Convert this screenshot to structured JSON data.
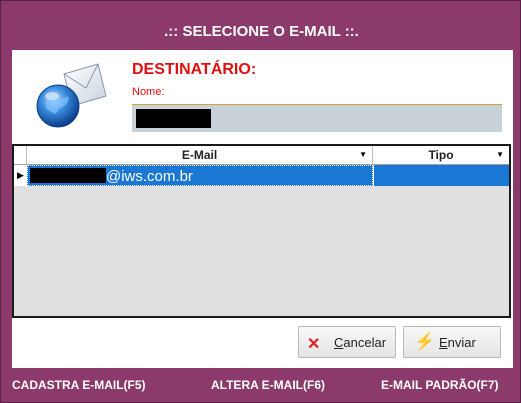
{
  "window": {
    "title": ".:: SELECIONE O E-MAIL ::."
  },
  "recipient": {
    "heading": "DESTINATÁRIO:",
    "name_label": "Nome:"
  },
  "grid": {
    "columns": [
      "E-Mail",
      "Tipo"
    ],
    "rows": [
      {
        "email_suffix": "@iws.com.br",
        "tipo": ""
      }
    ]
  },
  "buttons": {
    "cancel_label_u": "C",
    "cancel_label_rest": "ancelar",
    "send_label_u": "E",
    "send_label_rest": "nviar"
  },
  "footer": {
    "f5": "CADASTRA E-MAIL(F5)",
    "f6": "ALTERA E-MAIL(F6)",
    "f7": "E-MAIL PADRÃO(F7)"
  },
  "colors": {
    "frame": "#8b3a6b",
    "accent_red": "#e01010",
    "selection": "#1a78d4"
  },
  "icons": [
    "email-globe-icon",
    "cancel-x-icon",
    "lightning-icon"
  ]
}
